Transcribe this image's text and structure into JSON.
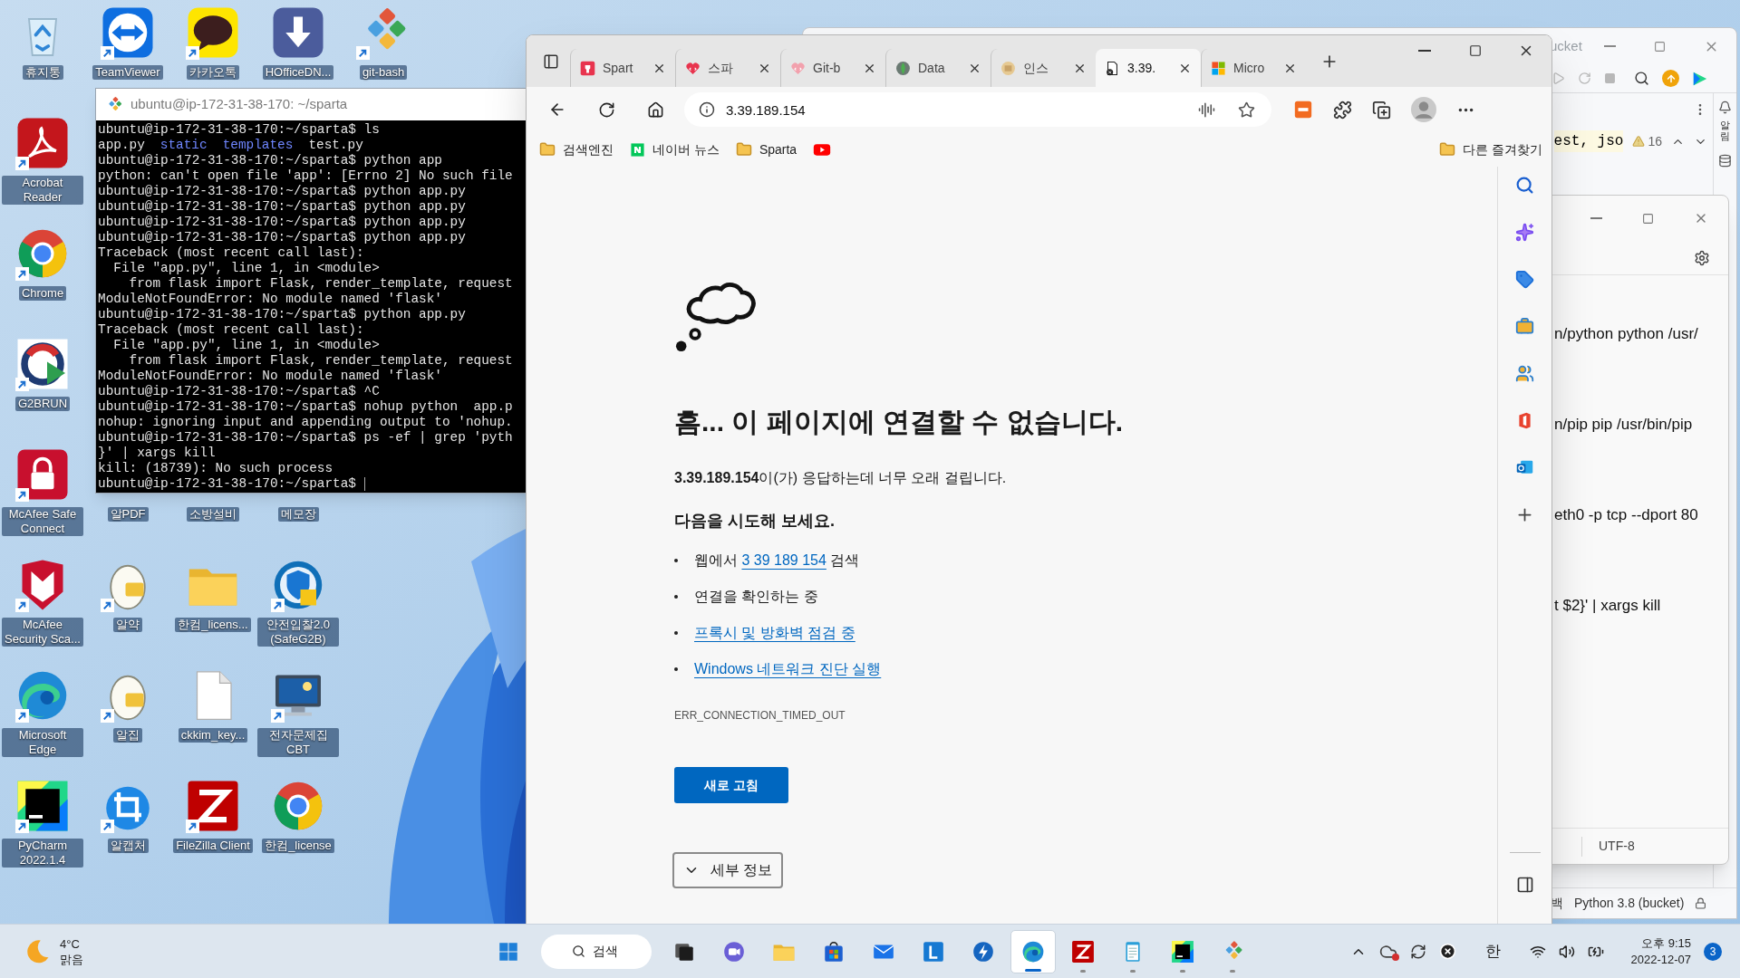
{
  "desktop": {
    "icon_rows": [
      [
        {
          "label": "휴지통",
          "kind": "recycle",
          "shortcut": false
        },
        {
          "label": "TeamViewer",
          "kind": "teamviewer",
          "shortcut": true
        },
        {
          "label": "카카오톡",
          "kind": "kakao",
          "shortcut": true
        },
        {
          "label": "HOfficeDN...",
          "kind": "download",
          "shortcut": false
        },
        {
          "label": "git-bash",
          "kind": "git",
          "shortcut": true
        }
      ],
      [
        {
          "label": "Acrobat Reader",
          "kind": "acrobat",
          "shortcut": true
        }
      ],
      [
        {
          "label": "Chrome",
          "kind": "chrome",
          "shortcut": true
        }
      ],
      [
        {
          "label": "G2BRUN",
          "kind": "g2b",
          "shortcut": true
        }
      ],
      [
        {
          "label": "McAfee Safe Connect",
          "kind": "mcafeelock",
          "shortcut": true
        },
        {
          "label": "알PDF"
        },
        {
          "label": "소방설비"
        },
        {
          "label": "메모장"
        }
      ],
      [
        {
          "label": "McAfee Security Sca...",
          "kind": "mcafee",
          "shortcut": true
        },
        {
          "label": "알약",
          "kind": "egg",
          "shortcut": true
        },
        {
          "label": "한컴_licens...",
          "kind": "folder",
          "shortcut": false
        },
        {
          "label": "안전입찰2.0 (SafeG2B)",
          "kind": "shieldblue",
          "shortcut": true
        }
      ],
      [
        {
          "label": "Microsoft Edge",
          "kind": "edge",
          "shortcut": true
        },
        {
          "label": "알집",
          "kind": "egg",
          "shortcut": true
        },
        {
          "label": "ckkim_key...",
          "kind": "file",
          "shortcut": false
        },
        {
          "label": "전자문제집 CBT",
          "kind": "monitor",
          "shortcut": true
        }
      ],
      [
        {
          "label": "PyCharm 2022.1.4",
          "kind": "pycharm",
          "shortcut": true
        },
        {
          "label": "알캡처",
          "kind": "crop",
          "shortcut": true
        },
        {
          "label": "FileZilla Client",
          "kind": "filezilla",
          "shortcut": true
        },
        {
          "label": "한컴_license",
          "kind": "chrome",
          "shortcut": false
        }
      ]
    ]
  },
  "terminal": {
    "title": "ubuntu@ip-172-31-38-170: ~/sparta",
    "lines": [
      {
        "text": "ubuntu@ip-172-31-38-170:~/sparta$ ls"
      },
      {
        "segments": [
          {
            "text": "app.py",
            "kind": "file"
          },
          {
            "text": "static",
            "kind": "dir"
          },
          {
            "text": "templates",
            "kind": "dir"
          },
          {
            "text": "test.py",
            "kind": "file"
          }
        ]
      },
      {
        "text": "ubuntu@ip-172-31-38-170:~/sparta$ python app"
      },
      {
        "text": "python: can't open file 'app': [Errno 2] No such file"
      },
      {
        "text": "ubuntu@ip-172-31-38-170:~/sparta$ python app.py"
      },
      {
        "text": "ubuntu@ip-172-31-38-170:~/sparta$ python app.py"
      },
      {
        "text": "ubuntu@ip-172-31-38-170:~/sparta$ python app.py"
      },
      {
        "text": "ubuntu@ip-172-31-38-170:~/sparta$ python app.py"
      },
      {
        "text": "Traceback (most recent call last):"
      },
      {
        "text": "  File \"app.py\", line 1, in <module>"
      },
      {
        "text": "    from flask import Flask, render_template, request"
      },
      {
        "text": "ModuleNotFoundError: No module named 'flask'"
      },
      {
        "text": "ubuntu@ip-172-31-38-170:~/sparta$ python app.py"
      },
      {
        "text": "Traceback (most recent call last):"
      },
      {
        "text": "  File \"app.py\", line 1, in <module>"
      },
      {
        "text": "    from flask import Flask, render_template, request"
      },
      {
        "text": "ModuleNotFoundError: No module named 'flask'"
      },
      {
        "text": "ubuntu@ip-172-31-38-170:~/sparta$ ^C"
      },
      {
        "text": "ubuntu@ip-172-31-38-170:~/sparta$ nohup python  app.p"
      },
      {
        "text": "nohup: ignoring input and appending output to 'nohup."
      },
      {
        "text": "ubuntu@ip-172-31-38-170:~/sparta$ ps -ef | grep 'pyth"
      },
      {
        "text": "}' | xargs kill"
      },
      {
        "text": "kill: (18739): No such process"
      },
      {
        "text": "ubuntu@ip-172-31-38-170:~/sparta$ "
      }
    ]
  },
  "browser": {
    "tabs": [
      {
        "title": "Spart",
        "kind": "sparta",
        "selected": false
      },
      {
        "title": "스파",
        "kind": "heart",
        "selected": false
      },
      {
        "title": "Git-b",
        "kind": "heartpale",
        "selected": false
      },
      {
        "title": "Data",
        "kind": "mongo",
        "selected": false
      },
      {
        "title": "인스",
        "kind": "box",
        "selected": false
      },
      {
        "title": "3.39.",
        "kind": "broken",
        "selected": true
      },
      {
        "title": "Micro",
        "kind": "microsoft",
        "selected": false
      }
    ],
    "address": "3.39.189.154",
    "bookmarks": [
      {
        "label": "검색엔진",
        "kind": "folder"
      },
      {
        "label": "네이버 뉴스",
        "kind": "naver"
      },
      {
        "label": "Sparta",
        "kind": "folder"
      },
      {
        "kind": "youtube"
      }
    ],
    "other_bookmarks": "다른 즐겨찾기",
    "error_page": {
      "title": "흠... 이 페이지에 연결할 수 없습니다.",
      "message": "**3.39.189.154**이(가) 응답하는데 너무 오래 걸립니다.",
      "suggestions_heading": "다음을 시도해 보세요.",
      "suggestions": [
        {
          "kind": "search",
          "before": "웹에서",
          "link": "3 39 189 154",
          "after": "검색"
        },
        {
          "kind": "text",
          "text": "연결을 확인하는 중"
        },
        {
          "kind": "link",
          "text": "프록시 및 방화벽 점검 중"
        },
        {
          "kind": "link",
          "text": "Windows 네트워크 진단 실행"
        }
      ],
      "error_code": "ERR_CONNECTION_TIMED_OUT",
      "refresh_button": "새로 고침",
      "details_button": "세부 정보"
    },
    "sidebar": [
      {
        "kind": "search"
      },
      {
        "kind": "sparkle"
      },
      {
        "kind": "tag"
      },
      {
        "kind": "toolbox"
      },
      {
        "kind": "people"
      },
      {
        "kind": "office"
      },
      {
        "kind": "outlook"
      },
      {
        "kind": "plus"
      }
    ]
  },
  "pycharm": {
    "title": "ucket",
    "code": "est, jso",
    "warnings": "16",
    "tool_window": "알림",
    "status_left": "백",
    "interpreter": "Python 3.8 (bucket)"
  },
  "notepad": {
    "lines": [
      "n/python python /usr/",
      "n/pip pip /usr/bin/pip",
      "eth0 -p tcp --dport 80",
      "t $2}' | xargs kill"
    ],
    "encoding": "UTF-8"
  },
  "taskbar": {
    "weather": {
      "temp": "4°C",
      "condition": "맑음"
    },
    "apps": [
      {
        "kind": "windows",
        "running": false,
        "selected": false
      },
      {
        "kind": "search",
        "label": "검색"
      },
      {
        "kind": "taskview",
        "running": false,
        "selected": false
      },
      {
        "kind": "chat",
        "running": false,
        "selected": false
      },
      {
        "kind": "folder",
        "running": false,
        "selected": false
      },
      {
        "kind": "store",
        "running": false,
        "selected": false
      },
      {
        "kind": "mail",
        "running": false,
        "selected": false
      },
      {
        "kind": "ltile",
        "running": false,
        "selected": false
      },
      {
        "kind": "bolt",
        "running": false,
        "selected": false
      },
      {
        "kind": "edge",
        "running": true,
        "selected": true
      },
      {
        "kind": "filezilla",
        "running": true,
        "selected": false
      },
      {
        "kind": "notepad",
        "running": true,
        "selected": false
      },
      {
        "kind": "pycharm",
        "running": true,
        "selected": false
      },
      {
        "kind": "git",
        "running": true,
        "selected": false
      }
    ],
    "ime": "한",
    "time": "오후 9:15",
    "date": "2022-12-07",
    "notifications": "3"
  }
}
